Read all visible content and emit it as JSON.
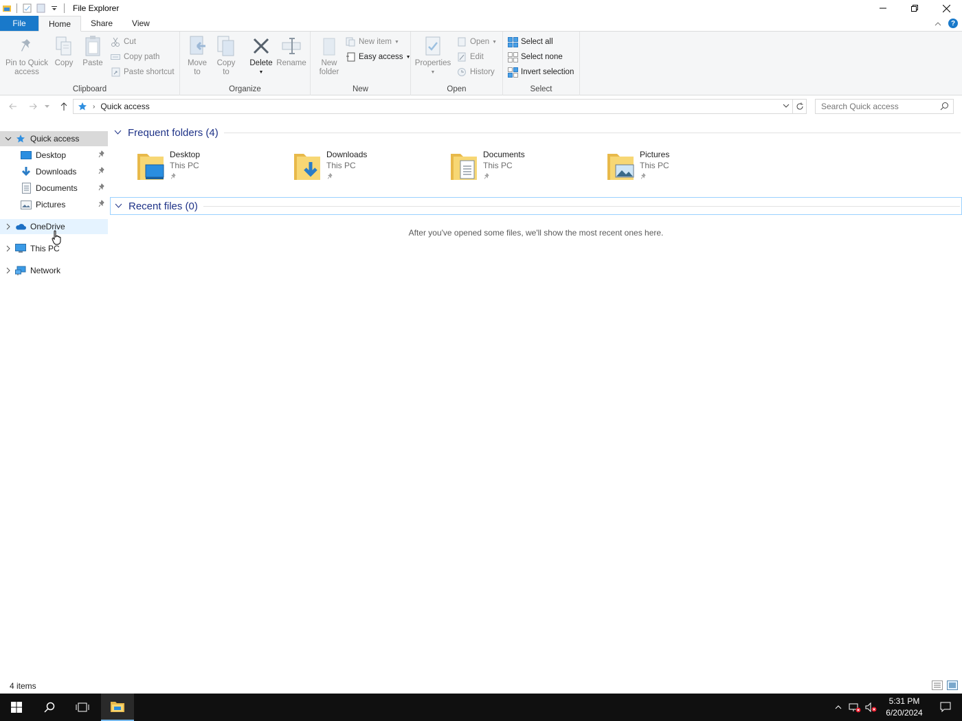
{
  "window": {
    "title": "File Explorer"
  },
  "ribbon_tabs": [
    "File",
    "Home",
    "Share",
    "View"
  ],
  "ribbon": {
    "clipboard": {
      "label": "Clipboard",
      "pin_quick_access": [
        "Pin to Quick",
        "access"
      ],
      "copy": "Copy",
      "paste": "Paste",
      "cut": "Cut",
      "copy_path": "Copy path",
      "paste_shortcut": "Paste shortcut"
    },
    "organize": {
      "label": "Organize",
      "move_to": [
        "Move",
        "to"
      ],
      "copy_to": [
        "Copy",
        "to"
      ],
      "delete": "Delete",
      "rename": "Rename"
    },
    "new": {
      "label": "New",
      "new_folder": [
        "New",
        "folder"
      ],
      "new_item": "New item",
      "easy_access": "Easy access"
    },
    "open": {
      "label": "Open",
      "properties": "Properties",
      "open": "Open",
      "edit": "Edit",
      "history": "History"
    },
    "select": {
      "label": "Select",
      "select_all": "Select all",
      "select_none": "Select none",
      "invert_selection": "Invert selection"
    }
  },
  "address": {
    "path": "Quick access"
  },
  "search": {
    "placeholder": "Search Quick access"
  },
  "nav_pane": {
    "quick_access": "Quick access",
    "pinned": [
      "Desktop",
      "Downloads",
      "Documents",
      "Pictures"
    ],
    "onedrive": "OneDrive",
    "this_pc": "This PC",
    "network": "Network"
  },
  "content": {
    "frequent_header": "Frequent folders (4)",
    "folders": [
      {
        "name": "Desktop",
        "location": "This PC",
        "icon": "desktop-folder-icon"
      },
      {
        "name": "Downloads",
        "location": "This PC",
        "icon": "downloads-folder-icon"
      },
      {
        "name": "Documents",
        "location": "This PC",
        "icon": "documents-folder-icon"
      },
      {
        "name": "Pictures",
        "location": "This PC",
        "icon": "pictures-folder-icon"
      }
    ],
    "recent_header": "Recent files (0)",
    "recent_empty": "After you've opened some files, we'll show the most recent ones here."
  },
  "status": {
    "item_count": "4 items"
  },
  "taskbar": {
    "time": "5:31 PM",
    "date": "6/20/2024"
  },
  "colors": {
    "accent": "#1979ca",
    "header_text": "#1e3287",
    "taskbar": "#101010"
  }
}
